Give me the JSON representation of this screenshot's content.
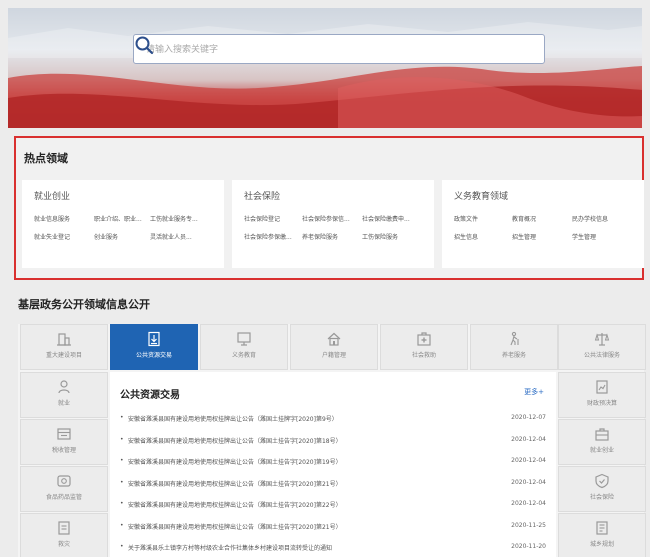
{
  "search": {
    "placeholder": "请输入搜索关键字"
  },
  "hot": {
    "title": "热点领域",
    "cards": [
      {
        "title": "就业创业",
        "links": [
          "就业信息服务",
          "职业介绍、职业...",
          "工伤就业服务专...",
          "就业失业登记",
          "创业服务",
          "灵活就业人员..."
        ]
      },
      {
        "title": "社会保险",
        "links": [
          "社会保险登记",
          "社会保险参保信...",
          "社会保险缴费申...",
          "社会保险参保缴...",
          "养老保险服务",
          "工伤保险服务"
        ]
      },
      {
        "title": "义务教育领域",
        "links": [
          "政策文件",
          "教育概况",
          "民办学校信息",
          "招生信息",
          "招生管理",
          "学生管理"
        ]
      }
    ]
  },
  "section": {
    "title": "基层政务公开领域信息公开",
    "top_tabs": [
      {
        "label": "重大建设项目",
        "icon": "building-icon"
      },
      {
        "label": "公共资源交易",
        "icon": "download-document-icon"
      },
      {
        "label": "义务教育",
        "icon": "monitor-icon"
      },
      {
        "label": "户籍管理",
        "icon": "home-icon"
      },
      {
        "label": "社会救助",
        "icon": "medical-icon"
      },
      {
        "label": "养老服务",
        "icon": "elderly-icon"
      },
      {
        "label": "公共法律服务",
        "icon": "scales-icon"
      }
    ],
    "left_tabs": [
      {
        "label": "就业",
        "icon": "person-icon"
      },
      {
        "label": "税收管理",
        "icon": "tax-icon"
      },
      {
        "label": "食品药品监管",
        "icon": "food-icon"
      },
      {
        "label": "救灾",
        "icon": "disaster-icon"
      }
    ],
    "right_tabs": [
      {
        "label": "财政预决算",
        "icon": "finance-icon"
      },
      {
        "label": "就业创业",
        "icon": "briefcase-icon"
      },
      {
        "label": "社会保险",
        "icon": "shield-icon"
      },
      {
        "label": "城乡规划",
        "icon": "plan-icon"
      }
    ],
    "content": {
      "title": "公共资源交易",
      "more": "更多+",
      "items": [
        {
          "text": "安徽省濉溪县国有建设用地使用权挂牌出让公告（濉国土挂牌字[2020]第9号）",
          "date": "2020-12-07"
        },
        {
          "text": "安徽省濉溪县国有建设用地使用权挂牌出让公告（濉国土挂告字[2020]第18号）",
          "date": "2020-12-04"
        },
        {
          "text": "安徽省濉溪县国有建设用地使用权挂牌出让公告（濉国土挂告字[2020]第19号）",
          "date": "2020-12-04"
        },
        {
          "text": "安徽省濉溪县国有建设用地使用权挂牌出让公告（濉国土挂告字[2020]第21号）",
          "date": "2020-12-04"
        },
        {
          "text": "安徽省濉溪县国有建设用地使用权挂牌出让公告（濉国土挂告字[2020]第22号）",
          "date": "2020-12-04"
        },
        {
          "text": "安徽省濉溪县国有建设用地使用权挂牌出让公告（濉国土挂告字[2020]第21号）",
          "date": "2020-11-25"
        },
        {
          "text": "关于濉溪县乐土镇李方村等村级农业合作社集体乡村建设项目流转受让的通知",
          "date": "2020-11-20"
        }
      ]
    }
  },
  "colors": {
    "accent": "#1f64b3",
    "highlight_border": "#d9302f"
  }
}
